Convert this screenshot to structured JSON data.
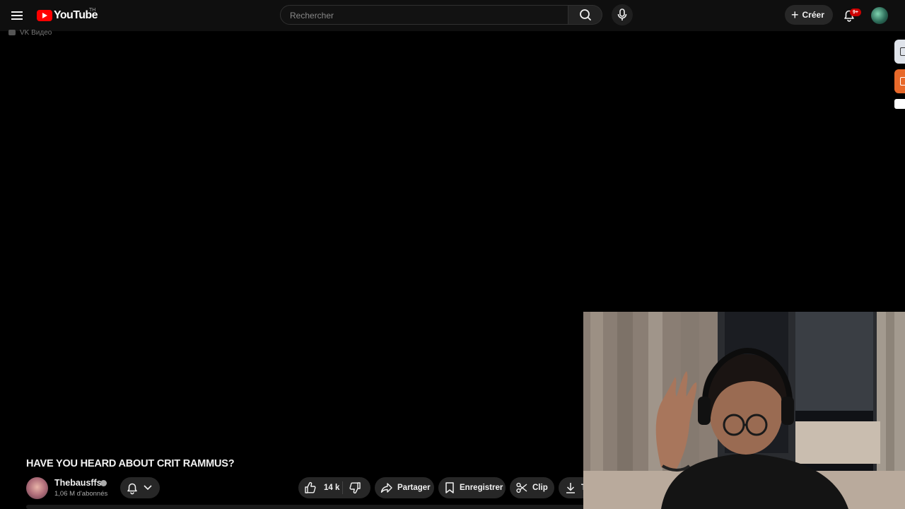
{
  "header": {
    "logo_text": "YouTube",
    "logo_region": "TH",
    "search": {
      "placeholder": "Rechercher"
    },
    "create_label": "Créer",
    "notifications_badge": "9+"
  },
  "overlay": {
    "vk_label": "VK Видео"
  },
  "video": {
    "title": "HAVE YOU HEARD ABOUT CRIT RAMMUS?",
    "channel": {
      "name": "Thebausffs",
      "subscribers": "1,06 M d'abonnés"
    },
    "actions": {
      "likes": "14 k",
      "share": "Partager",
      "save": "Enregistrer",
      "clip": "Clip",
      "download": "T"
    }
  },
  "colors": {
    "background": "#000000",
    "topbar": "#0f0f0f",
    "pill": "#272727",
    "brand_red": "#ff0000",
    "badge_red": "#cc0000"
  }
}
